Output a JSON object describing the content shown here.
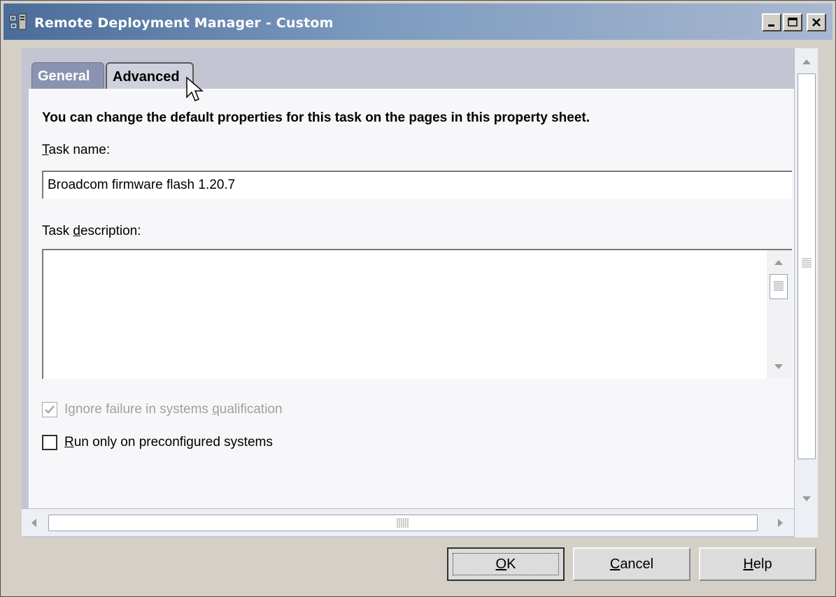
{
  "window": {
    "title": "Remote Deployment Manager - Custom",
    "controls": {
      "minimize": "_",
      "maximize": "□",
      "close": "×"
    }
  },
  "tabs": [
    {
      "label": "General"
    },
    {
      "label": "Advanced"
    }
  ],
  "general": {
    "description": "You can change the default properties for this task on the pages in this property sheet.",
    "task_name": {
      "label_pre": "",
      "label_u": "T",
      "label_post": "ask name:",
      "value": "Broadcom firmware flash 1.20.7"
    },
    "task_description": {
      "label_pre": "Task ",
      "label_u": "d",
      "label_post": "escription:",
      "value": ""
    },
    "checkboxes": [
      {
        "label_pre": "Ignore failure in systems ",
        "label_u": "q",
        "label_post": "ualification",
        "checked": true,
        "disabled": true
      },
      {
        "label_pre": "",
        "label_u": "R",
        "label_post": "un only on preconfigured systems",
        "checked": false,
        "disabled": false
      }
    ]
  },
  "buttons": {
    "ok": {
      "pre": "",
      "u": "O",
      "post": "K"
    },
    "cancel": {
      "pre": "",
      "u": "C",
      "post": "ancel"
    },
    "help": {
      "pre": "",
      "u": "H",
      "post": "elp"
    }
  },
  "colors": {
    "title_gradient_start": "#4a6c9a",
    "tab_general": "#8a93b2",
    "panel": "#f7f7f9",
    "disabled_text": "#a0a0a0"
  },
  "icons": [
    "app-icon",
    "minimize-icon",
    "maximize-icon",
    "close-icon",
    "mouse-cursor-icon"
  ]
}
